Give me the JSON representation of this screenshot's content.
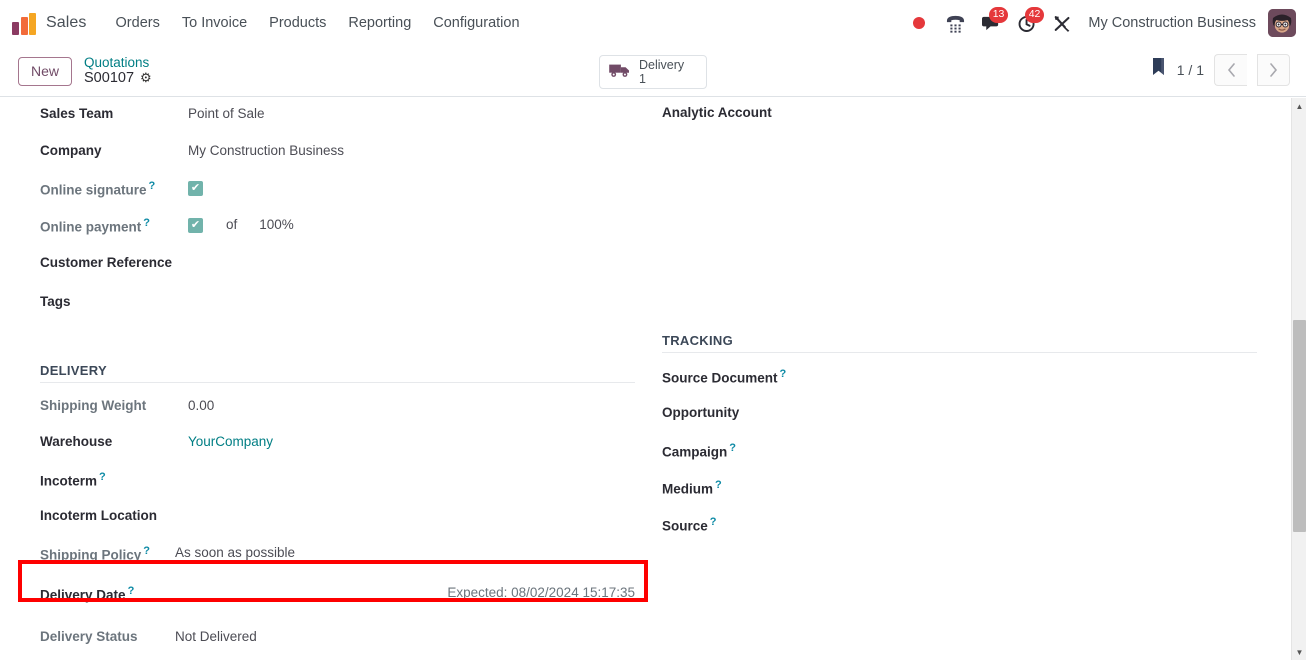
{
  "navbar": {
    "brand": "Sales",
    "brand_logo_icon": "sales-bar-chart-logo",
    "menu": [
      {
        "label": "Orders"
      },
      {
        "label": "To Invoice"
      },
      {
        "label": "Products"
      },
      {
        "label": "Reporting"
      },
      {
        "label": "Configuration"
      }
    ],
    "systray": {
      "record_indicator_icon": "red-record-dot",
      "phone_icon": "phone-dialpad-icon",
      "messages_icon": "chat-bubble-icon",
      "messages_count": "13",
      "activities_icon": "clock-activity-icon",
      "activities_count": "42",
      "tools_icon": "wrench-screwdriver-icon",
      "company": "My Construction Business",
      "avatar_icon": "user-avatar"
    }
  },
  "control_panel": {
    "new_button": "New",
    "breadcrumb_parent": "Quotations",
    "breadcrumb_current": "S00107",
    "settings_icon": "gear-icon",
    "smart_button": {
      "icon": "delivery-truck-icon",
      "label": "Delivery",
      "count": "1"
    },
    "flag_icon": "bookmark-flag-icon",
    "pager": "1 / 1",
    "prev_icon": "chevron-left-icon",
    "next_icon": "chevron-right-icon"
  },
  "form": {
    "left_top": [
      {
        "label": "Sales Team",
        "value": "Point of Sale",
        "muted": false,
        "help": false
      },
      {
        "label": "Company",
        "value": "My Construction Business",
        "muted": false,
        "help": false
      },
      {
        "label": "Online signature",
        "value": "",
        "muted": true,
        "help": true
      },
      {
        "label": "Online payment",
        "value": "",
        "muted": true,
        "help": true
      },
      {
        "label": "Customer Reference",
        "value": "",
        "muted": false,
        "help": false
      },
      {
        "label": "Tags",
        "value": "",
        "muted": false,
        "help": false
      }
    ],
    "online_payment_of": "of",
    "online_payment_percent": "100%",
    "checkbox_glyph": "✔",
    "right_top": [
      {
        "label": "Analytic Account",
        "value": "",
        "muted": false,
        "help": false
      }
    ],
    "delivery_section": {
      "title": "DELIVERY",
      "rows": [
        {
          "label": "Shipping Weight",
          "value": "0.00",
          "muted": true,
          "help": false,
          "link": false
        },
        {
          "label": "Warehouse",
          "value": "YourCompany",
          "muted": false,
          "help": false,
          "link": true
        },
        {
          "label": "Incoterm",
          "value": "",
          "muted": false,
          "help": true,
          "link": false
        },
        {
          "label": "Incoterm Location",
          "value": "",
          "muted": false,
          "help": false,
          "link": false
        },
        {
          "label": "Shipping Policy",
          "value": "As soon as possible",
          "muted": true,
          "help": true,
          "link": false
        }
      ],
      "delivery_date": {
        "label": "Delivery Date",
        "help": true,
        "value": "Expected: 08/02/2024 15:17:35"
      },
      "delivery_status": {
        "label": "Delivery Status",
        "value": "Not Delivered"
      }
    },
    "tracking_section": {
      "title": "TRACKING",
      "rows": [
        {
          "label": "Source Document",
          "value": "",
          "help": true
        },
        {
          "label": "Opportunity",
          "value": "",
          "help": false
        },
        {
          "label": "Campaign",
          "value": "",
          "help": true
        },
        {
          "label": "Medium",
          "value": "",
          "help": true
        },
        {
          "label": "Source",
          "value": "",
          "help": true
        }
      ]
    }
  },
  "annotation": {
    "highlight_color": "#fe0000",
    "highlight_target": "delivery-date-row"
  },
  "colors": {
    "brand_purple": "#714b67",
    "link_teal": "#017e84",
    "checkbox_teal": "#71b3ab",
    "badge_red": "#e5383b",
    "help_blue": "#0d8aa5"
  }
}
